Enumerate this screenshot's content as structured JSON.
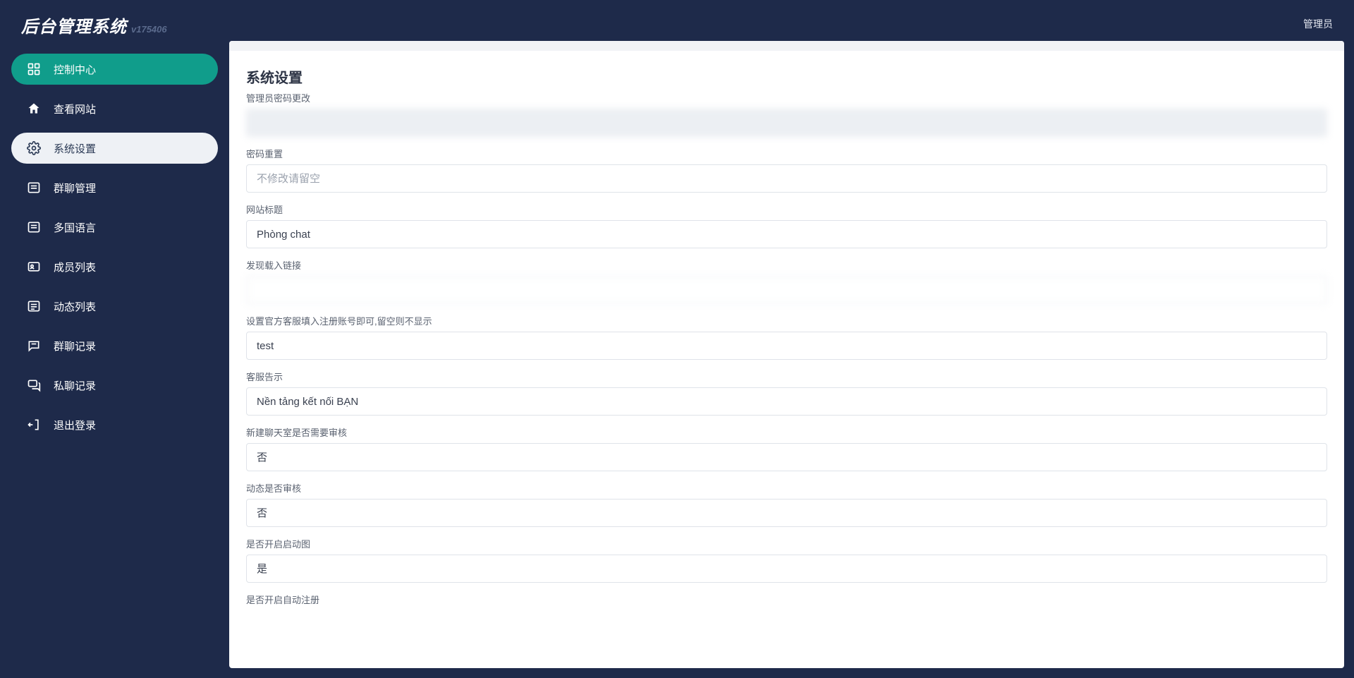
{
  "header": {
    "title": "后台管理系统",
    "version": "v175406",
    "user_role": "管理员"
  },
  "sidebar": {
    "items": [
      {
        "key": "control-center",
        "label": "控制中心"
      },
      {
        "key": "view-site",
        "label": "查看网站"
      },
      {
        "key": "system-settings",
        "label": "系统设置"
      },
      {
        "key": "group-chat",
        "label": "群聊管理"
      },
      {
        "key": "i18n",
        "label": "多国语言"
      },
      {
        "key": "members",
        "label": "成员列表"
      },
      {
        "key": "feeds",
        "label": "动态列表"
      },
      {
        "key": "group-log",
        "label": "群聊记录"
      },
      {
        "key": "dm-log",
        "label": "私聊记录"
      },
      {
        "key": "logout",
        "label": "退出登录"
      }
    ]
  },
  "page": {
    "title": "系统设置",
    "fields": {
      "admin_password_change": {
        "label": "管理员密码更改",
        "value": ""
      },
      "password_reset": {
        "label": "密码重置",
        "placeholder": "不修改请留空",
        "value": ""
      },
      "site_title": {
        "label": "网站标题",
        "value": "Phòng chat"
      },
      "discover_link": {
        "label": "发现载入链接",
        "value": ""
      },
      "official_cs": {
        "label": "设置官方客服填入注册账号即可,留空则不显示",
        "value": "test"
      },
      "cs_notice": {
        "label": "客服告示",
        "value": "Nền tảng kết nối BẠN"
      },
      "new_room_review": {
        "label": "新建聊天室是否需要审核",
        "value": "否"
      },
      "feed_review": {
        "label": "动态是否审核",
        "value": "否"
      },
      "enable_splash": {
        "label": "是否开启启动图",
        "value": "是"
      },
      "enable_auto_register": {
        "label": "是否开启自动注册"
      }
    },
    "select_options": {
      "yes": "是",
      "no": "否"
    }
  }
}
